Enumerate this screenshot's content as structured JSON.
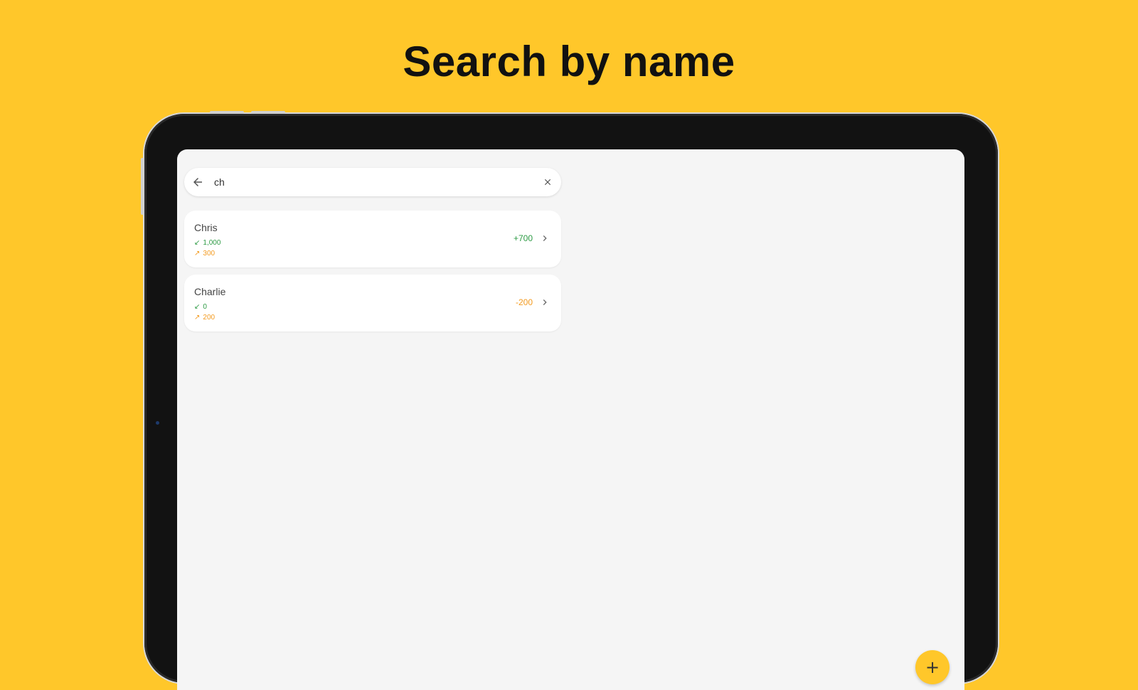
{
  "headline": "Search by name",
  "search": {
    "value": "ch",
    "back_icon": "arrow-left-icon",
    "clear_icon": "close-icon"
  },
  "results": [
    {
      "name": "Chris",
      "received": "1,000",
      "sent": "300",
      "balance": "+700",
      "balance_color": "#2e9b45"
    },
    {
      "name": "Charlie",
      "received": "0",
      "sent": "200",
      "balance": "-200",
      "balance_color": "#f39a1f"
    }
  ],
  "fab": {
    "icon": "plus-icon",
    "label": "+"
  },
  "colors": {
    "background": "#FFC72A",
    "screen": "#F5F5F5",
    "received": "#2e9b45",
    "sent": "#f39a1f"
  }
}
